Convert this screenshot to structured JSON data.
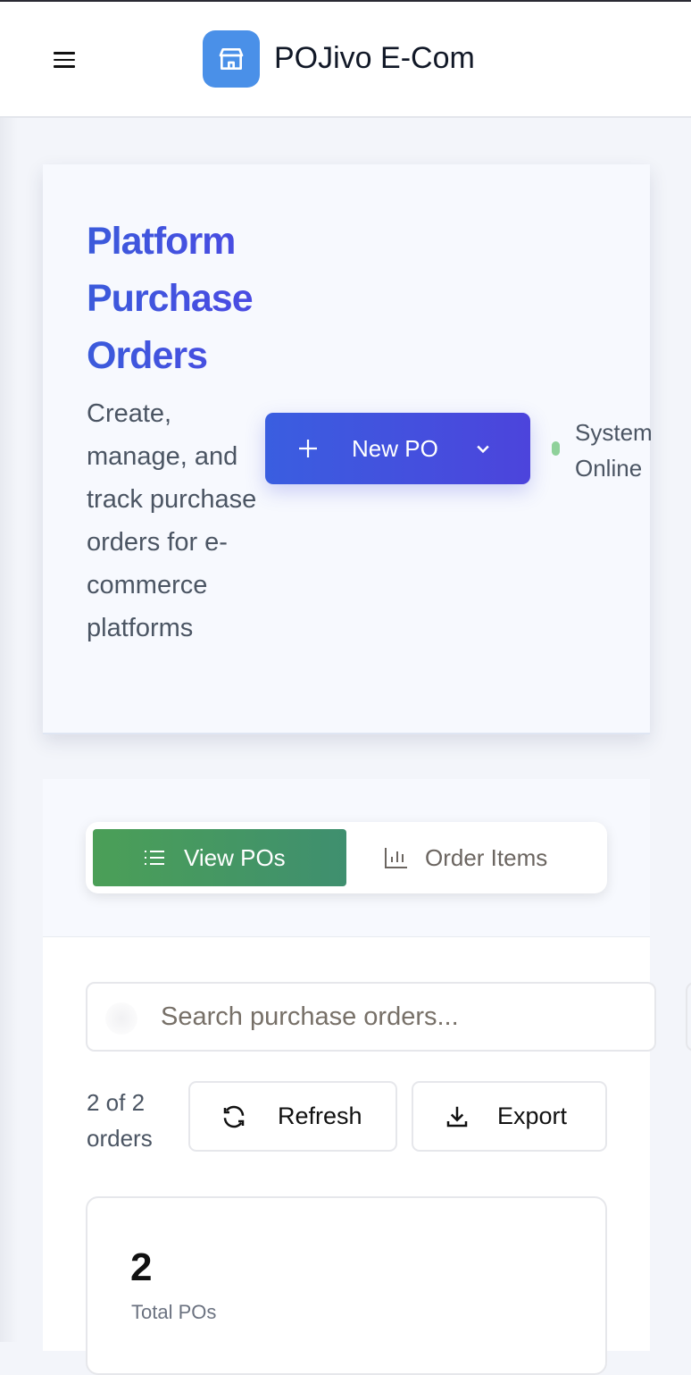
{
  "header": {
    "brand": "POJivo E-Com",
    "menu_icon": "hamburger-icon",
    "logo_icon": "store-icon"
  },
  "hero": {
    "title": "Platform Purchase Orders",
    "description": "Create, manage, and track purchase orders for e-commerce platforms",
    "new_po_label": "New PO",
    "status_text": "System Online",
    "status_color": "#8fd19a",
    "accent": "#3b5bdb"
  },
  "tabs": [
    {
      "label": "View POs",
      "icon": "list-icon",
      "active": true
    },
    {
      "label": "Order Items",
      "icon": "bar-chart-icon",
      "active": false
    }
  ],
  "toolbar": {
    "search_placeholder": "Search purchase orders...",
    "count_text": "2 of 2 orders",
    "refresh_label": "Refresh",
    "export_label": "Export"
  },
  "stats": [
    {
      "value": "2",
      "label": "Total POs"
    }
  ]
}
